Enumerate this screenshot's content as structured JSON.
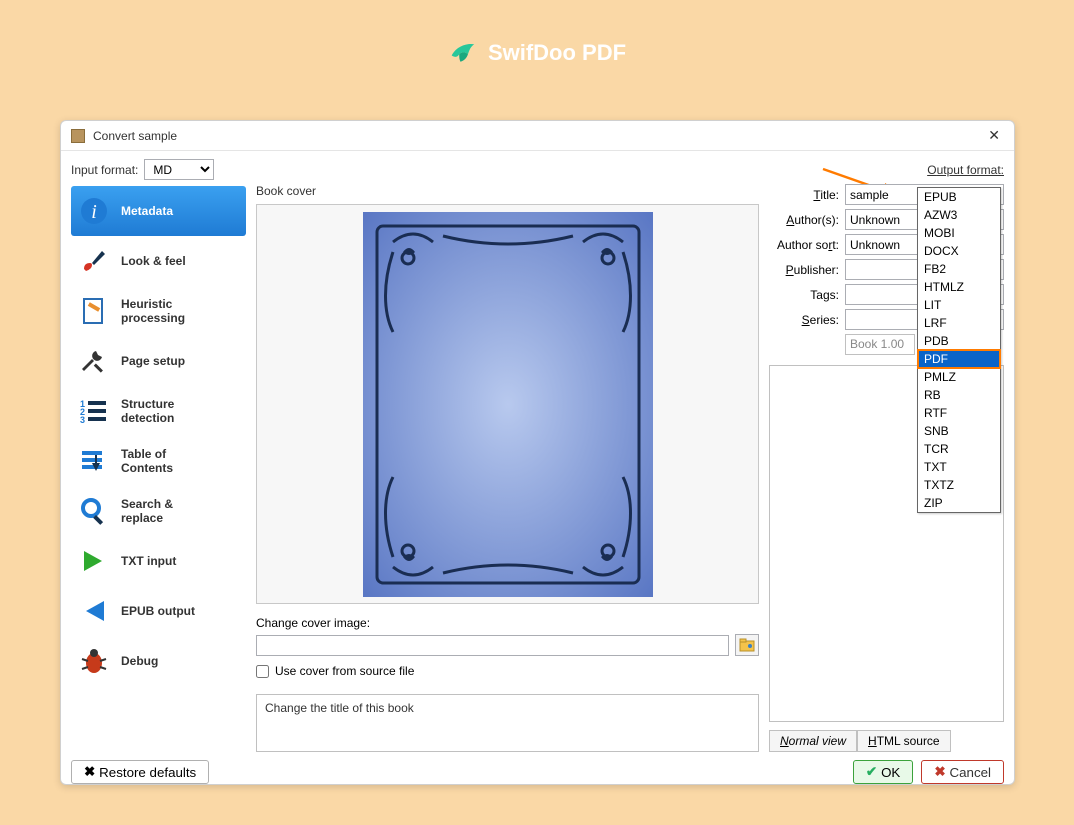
{
  "brand": {
    "name": "SwifDoo PDF"
  },
  "dialog": {
    "title": "Convert sample",
    "input_format_label": "Input format:",
    "input_format_value": "MD",
    "output_format_label": "Output format:",
    "output_options": [
      "EPUB",
      "AZW3",
      "MOBI",
      "DOCX",
      "FB2",
      "HTMLZ",
      "LIT",
      "LRF",
      "PDB",
      "PDF",
      "PMLZ",
      "RB",
      "RTF",
      "SNB",
      "TCR",
      "TXT",
      "TXTZ",
      "ZIP"
    ],
    "output_selected": "PDF"
  },
  "sidebar": {
    "items": [
      {
        "label": "Metadata",
        "icon": "info-icon"
      },
      {
        "label": "Look & feel",
        "icon": "brush-icon"
      },
      {
        "label": "Heuristic processing",
        "icon": "ruler-icon"
      },
      {
        "label": "Page setup",
        "icon": "tools-icon"
      },
      {
        "label": "Structure detection",
        "icon": "list-icon"
      },
      {
        "label": "Table of Contents",
        "icon": "toc-icon"
      },
      {
        "label": "Search & replace",
        "icon": "search-icon"
      },
      {
        "label": "TXT input",
        "icon": "arrow-right-green-icon"
      },
      {
        "label": "EPUB output",
        "icon": "arrow-left-blue-icon"
      },
      {
        "label": "Debug",
        "icon": "bug-icon"
      }
    ]
  },
  "cover": {
    "caption": "Book cover",
    "change_label": "Change cover image:",
    "change_value": "",
    "checkbox_label": "Use cover from source file"
  },
  "fields": {
    "title_label": "Title:",
    "title_value": "sample",
    "authors_label": "Author(s):",
    "authors_value": "Unknown",
    "authorsort_label": "Author sort:",
    "authorsort_value": "Unknown",
    "publisher_label": "Publisher:",
    "publisher_value": "",
    "tags_label": "Tags:",
    "tags_value": "",
    "series_label": "Series:",
    "series_value": "",
    "book_num": "Book 1.00"
  },
  "tabs": {
    "normal": "Normal view",
    "html": "HTML source"
  },
  "hint": "Change the title of this book",
  "footer": {
    "restore": "Restore defaults",
    "ok": "OK",
    "cancel": "Cancel"
  }
}
